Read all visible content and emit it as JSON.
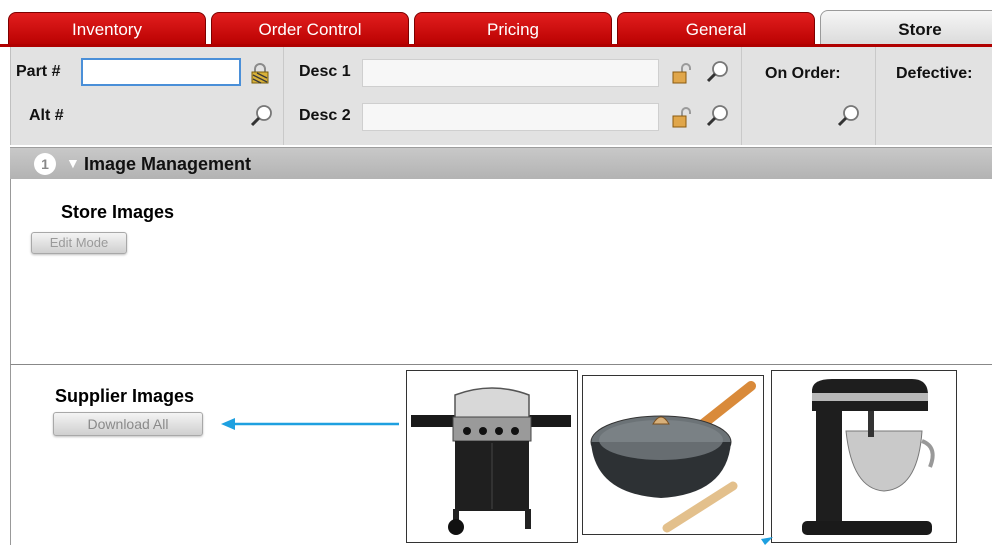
{
  "tabs": [
    {
      "label": "Inventory",
      "active": false
    },
    {
      "label": "Order Control",
      "active": false
    },
    {
      "label": "Pricing",
      "active": false
    },
    {
      "label": "General",
      "active": false
    },
    {
      "label": "Store",
      "active": true
    }
  ],
  "header": {
    "part_label": "Part #",
    "part_value": "",
    "alt_label": "Alt #",
    "desc1_label": "Desc 1",
    "desc1_value": "",
    "desc2_label": "Desc 2",
    "desc2_value": "",
    "on_order_label": "On Order:",
    "defective_label": "Defective:"
  },
  "section": {
    "number": "1",
    "title": "Image Management"
  },
  "store_images": {
    "title": "Store Images",
    "edit_button": "Edit Mode"
  },
  "supplier_images": {
    "title": "Supplier Images",
    "download_button": "Download All",
    "images": [
      {
        "name": "gas-grill"
      },
      {
        "name": "nonstick-wok-with-lid"
      },
      {
        "name": "stand-mixer"
      }
    ]
  },
  "colors": {
    "tab_red": "#cc1111",
    "active_tab": "#e6e6e6",
    "arrow_blue": "#1ea0e0",
    "focus_blue": "#4a8fd8"
  }
}
